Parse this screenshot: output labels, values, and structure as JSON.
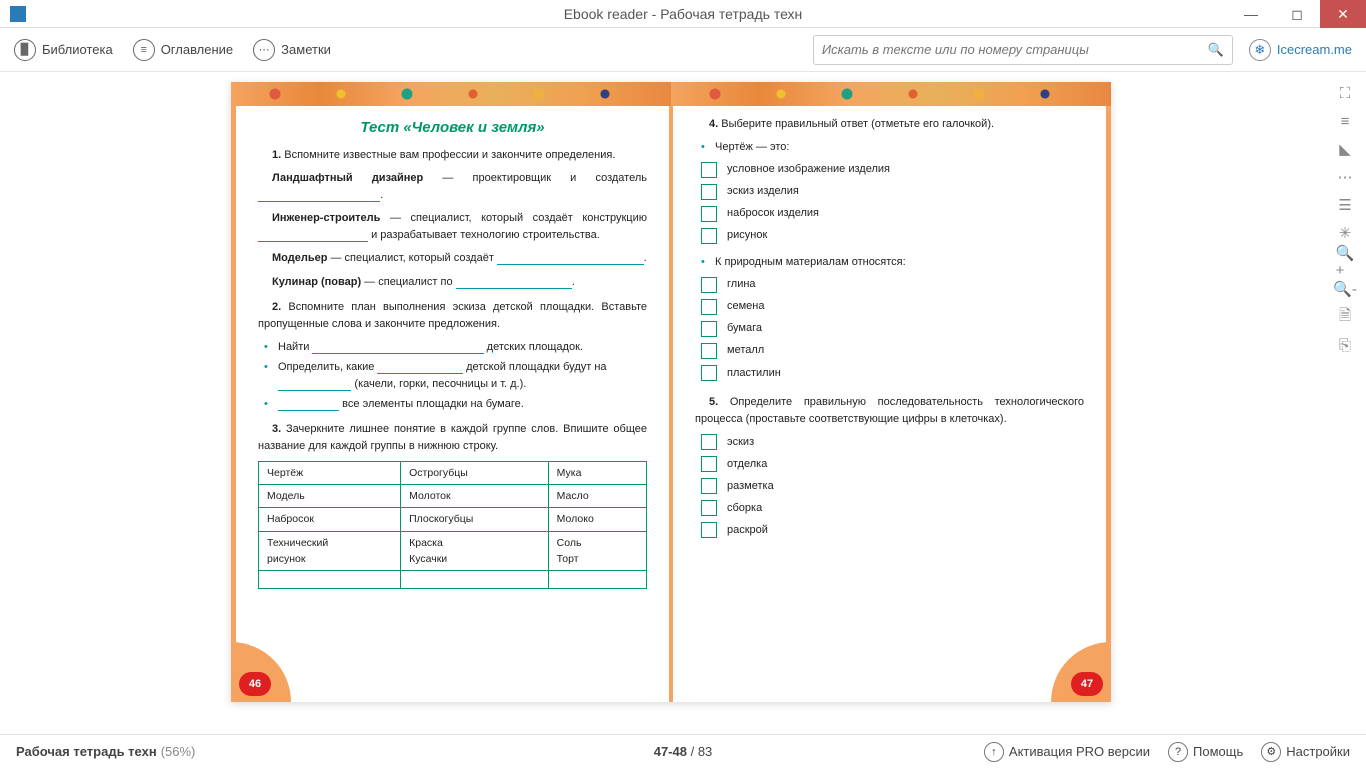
{
  "window": {
    "title": "Ebook reader - Рабочая тетрадь техн"
  },
  "toolbar": {
    "library": "Библиотека",
    "toc": "Оглавление",
    "notes": "Заметки",
    "search_placeholder": "Искать в тексте или по номеру страницы",
    "icecream": "Icecream.me"
  },
  "right_panel": [
    "fullscreen",
    "list",
    "bookmark",
    "note",
    "columns",
    "brightness",
    "zoom-in",
    "zoom-out",
    "file",
    "save"
  ],
  "statusbar": {
    "book_title": "Рабочая тетрадь техн",
    "progress": "(56%)",
    "pages_current": "47-48",
    "pages_total": "/ 83",
    "pro": "Активация PRO версии",
    "help": "Помощь",
    "settings": "Настройки"
  },
  "left_page": {
    "num": "46",
    "title": "Тест «Человек и земля»",
    "q1_intro_num": "1.",
    "q1_intro": "Вспомните известные вам профессии и закончите определения.",
    "p1a": "Ландшафтный дизайнер",
    "p1a_txt": " — проектировщик и созда­тель ",
    "p1b": "Инженер-строитель",
    "p1b_txt": " — специалист, который создаёт конструкцию ",
    "p1b_txt2": "и разрабатывает технологию строительства.",
    "p1c": "Модельер",
    "p1c_txt": " — специалист, который создаёт ",
    "p1d": "Кулинар (повар)",
    "p1d_txt": " — специалист по ",
    "q2_num": "2.",
    "q2": "Вспомните план выполнения эскиза детской пло­щадки. Вставьте пропущенные слова и закончите пред­ложения.",
    "q2_b1_a": "Найти ",
    "q2_b1_b": " детских площадок.",
    "q2_b2_a": "Определить, какие ",
    "q2_b2_b": " детской площадки будут на ",
    "q2_b2_c": " (качели, горки, песочницы и т. д.).",
    "q2_b3_a": " все элементы площадки на бумаге.",
    "q3_num": "3.",
    "q3": "Зачеркните лишнее понятие в каждой группе слов. Впишите общее название для каждой группы в нижнюю строку.",
    "table": {
      "c1": [
        "Чертёж",
        "Модель",
        "Набросок",
        "Технический",
        "рисунок"
      ],
      "c2": [
        "Острогубцы",
        "Молоток",
        "Плоскогубцы",
        "Краска",
        "Кусачки"
      ],
      "c3": [
        "Мука",
        "Масло",
        "Молоко",
        "Соль",
        "Торт"
      ]
    }
  },
  "right_page": {
    "num": "47",
    "q4_num": "4.",
    "q4": "Выберите правильный ответ (отметьте его галочкой).",
    "q4a_head": "Чертёж — это:",
    "q4a_opts": [
      "условное изображение изделия",
      "эскиз изделия",
      "набросок изделия",
      "рисунок"
    ],
    "q4b_head": "К природным материалам относятся:",
    "q4b_opts": [
      "глина",
      "семена",
      "бумага",
      "металл",
      "пластилин"
    ],
    "q5_num": "5.",
    "q5": "Определите правильную последовательность тех­нологического процесса (проставьте соответствующие цифры в клеточках).",
    "q5_opts": [
      "эскиз",
      "отделка",
      "разметка",
      "сборка",
      "раскрой"
    ]
  }
}
